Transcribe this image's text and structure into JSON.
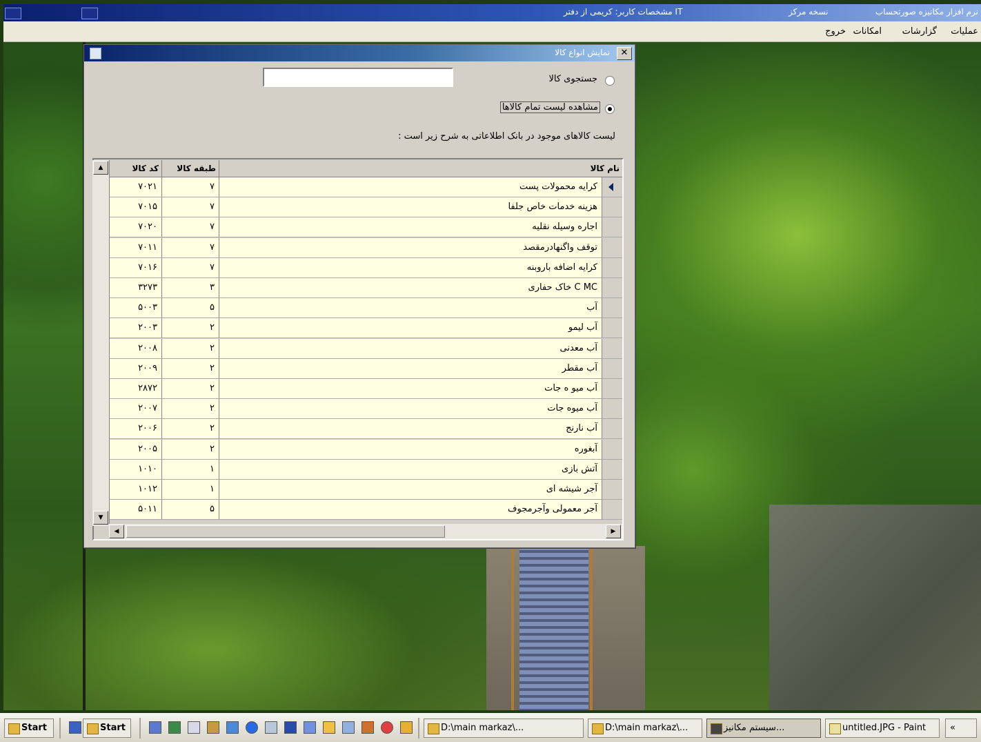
{
  "app": {
    "title_left": "مشخصات کاربر: کریمی از دفتر IT",
    "title_mid": "نسخه مرکز",
    "title_right": "نرم افزار مکانیزه صورتحساب"
  },
  "menu": [
    "عملیات",
    "گزارشات",
    "امکانات",
    "خروج"
  ],
  "dialog": {
    "title": "نمایش انواع کالا",
    "search_label": "جستجوی کالا",
    "search_value": "",
    "show_all_label": "مشاهده لیست تمام کالاها",
    "description": "لیست کالاهای موجود در بانک اطلاعاتی به شرح زیر است :",
    "selected_option": "show_all"
  },
  "grid": {
    "columns": [
      "نام کالا",
      "طبقه کالا",
      "کد کالا"
    ],
    "rows": [
      {
        "name": "کرایه محمولات پست",
        "category": "۷",
        "code": "۷۰۲۱"
      },
      {
        "name": "هزینه خدمات خاص جلفا",
        "category": "۷",
        "code": "۷۰۱۵"
      },
      {
        "name": "اجاره وسیله نقلیه",
        "category": "۷",
        "code": "۷۰۲۰"
      },
      {
        "name": "توقف واگنهادرمقصد",
        "category": "۷",
        "code": "۷۰۱۱"
      },
      {
        "name": "کرایه اضافه باروبنه",
        "category": "۷",
        "code": "۷۰۱۶"
      },
      {
        "name": "C MC خاک حفاری",
        "category": "۳",
        "code": "۳۲۷۳"
      },
      {
        "name": "آب",
        "category": "۵",
        "code": "۵۰۰۳"
      },
      {
        "name": "آب لیمو",
        "category": "۲",
        "code": "۲۰۰۳"
      },
      {
        "name": "آب معدنی",
        "category": "۲",
        "code": "۲۰۰۸"
      },
      {
        "name": "آب مقطر",
        "category": "۲",
        "code": "۲۰۰۹"
      },
      {
        "name": "آب میو ه جات",
        "category": "۲",
        "code": "۲۸۷۲"
      },
      {
        "name": "آب میوه جات",
        "category": "۲",
        "code": "۲۰۰۷"
      },
      {
        "name": "آب نارنج",
        "category": "۲",
        "code": "۲۰۰۶"
      },
      {
        "name": "آبغوره",
        "category": "۲",
        "code": "۲۰۰۵"
      },
      {
        "name": "آتش بازی",
        "category": "۱",
        "code": "۱۰۱۰"
      },
      {
        "name": "آجر شیشه ای",
        "category": "۱",
        "code": "۱۰۱۲"
      },
      {
        "name": "آجر معمولی وآجرمجوف",
        "category": "۵",
        "code": "۵۰۱۱"
      }
    ]
  },
  "taskbar": {
    "start1": "Start",
    "start2": "Start",
    "buttons": [
      "D:\\main markaz\\...",
      "D:\\main markaz\\...",
      "سیستم مکانیز...",
      "untitled.JPG - Paint"
    ],
    "tray": "«"
  }
}
